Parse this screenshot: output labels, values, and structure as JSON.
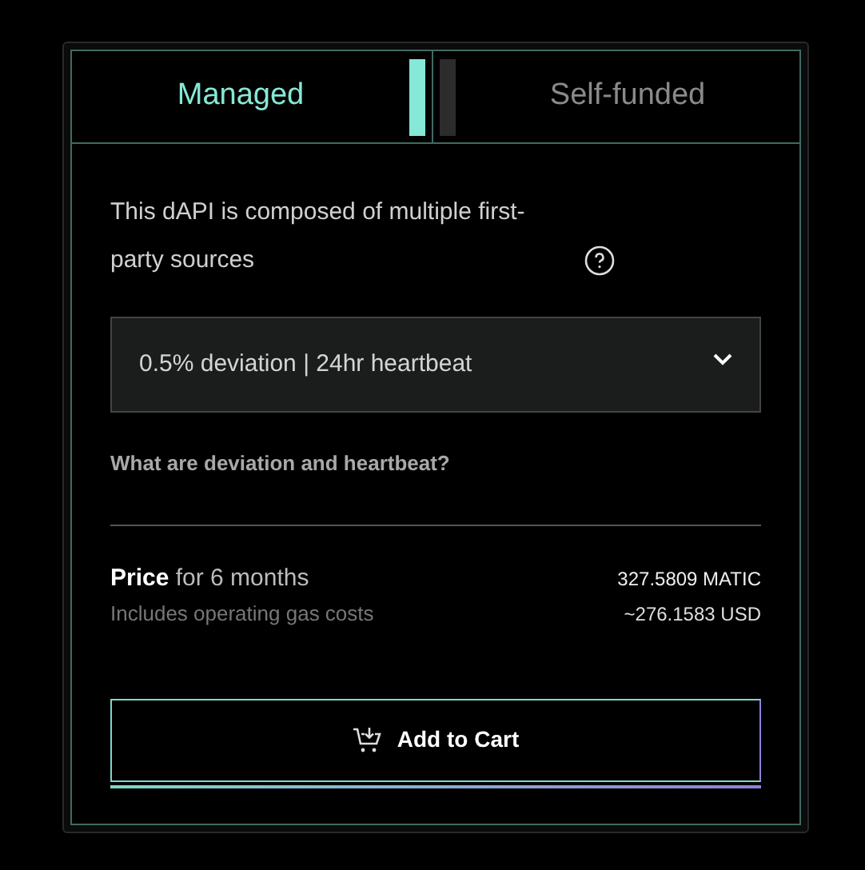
{
  "tabs": [
    {
      "label": "Managed",
      "selected": true
    },
    {
      "label": "Self-funded",
      "selected": false
    }
  ],
  "description": "This dAPI is composed of multiple first-party sources",
  "select": {
    "value": "0.5% deviation | 24hr heartbeat"
  },
  "help_link": "What are deviation and heartbeat?",
  "price": {
    "label": "**Price** for 6 months",
    "note": "Includes operating gas costs",
    "amount": "327.5809 MATIC",
    "converted": "~276.1583 USD"
  },
  "button": {
    "label": "Add to Cart"
  }
}
